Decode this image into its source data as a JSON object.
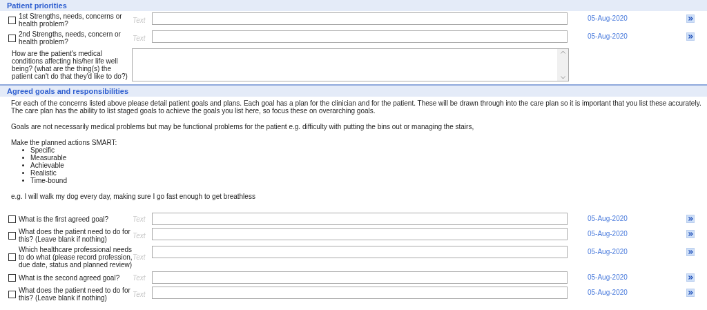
{
  "sections": [
    {
      "title": "Patient priorities",
      "rows": [
        {
          "kind": "field",
          "checked": false,
          "label": "1st Strengths, needs, concerns or health problem?",
          "hint": "Text",
          "date": "05-Aug-2020"
        },
        {
          "kind": "field",
          "checked": false,
          "label": "2nd Strengths, needs, concern or health problem?",
          "hint": "Text",
          "date": "05-Aug-2020"
        },
        {
          "kind": "textarea",
          "label": "How are the patient's medical conditions affecting his/her life well being? (what are the thing(s) the patient can't do that they'd like to do?)"
        }
      ]
    },
    {
      "title": "Agreed goals and responsibilities",
      "instructions": [
        {
          "kind": "paragraph",
          "text": "For each of the concerns listed above please detail patient goals and plans. Each goal has a plan for the clinician and for the patient.  These will be drawn through into the care plan so it is important that you list these accurately.  The care plan has the ability to list staged goals to achieve the goals you list here, so focus these on overarching goals."
        },
        {
          "kind": "paragraph",
          "text": "Goals are not necessarily medical problems but may be functional problems for the patient e.g. difficulty with putting the bins out or managing the stairs,"
        },
        {
          "kind": "list",
          "heading": "Make the planned actions SMART:",
          "items": [
            "Specific",
            "Measurable",
            "Achievable",
            "Realistic",
            "Time-bound"
          ]
        },
        {
          "kind": "paragraph",
          "text": "e.g. I will walk my dog every day, making sure I go fast enough to get breathless"
        }
      ],
      "rows": [
        {
          "kind": "field",
          "checked": false,
          "label": "What is the first agreed goal?",
          "hint": "Text",
          "date": "05-Aug-2020"
        },
        {
          "kind": "field",
          "checked": false,
          "label": "What does the patient need to do for this?  (Leave blank if nothing)",
          "hint": "Text",
          "date": "05-Aug-2020"
        },
        {
          "kind": "field",
          "checked": false,
          "label": "Which healthcare professional needs to do what (please record profession, due date, status and planned review)",
          "hint": "Text",
          "date": "05-Aug-2020"
        },
        {
          "kind": "field",
          "checked": false,
          "label": "What is the second agreed goal?",
          "hint": "Text",
          "date": "05-Aug-2020"
        },
        {
          "kind": "field",
          "checked": false,
          "label": "What does the patient need to do for this?  (Leave blank if nothing)",
          "hint": "Text",
          "date": "05-Aug-2020"
        }
      ]
    }
  ]
}
